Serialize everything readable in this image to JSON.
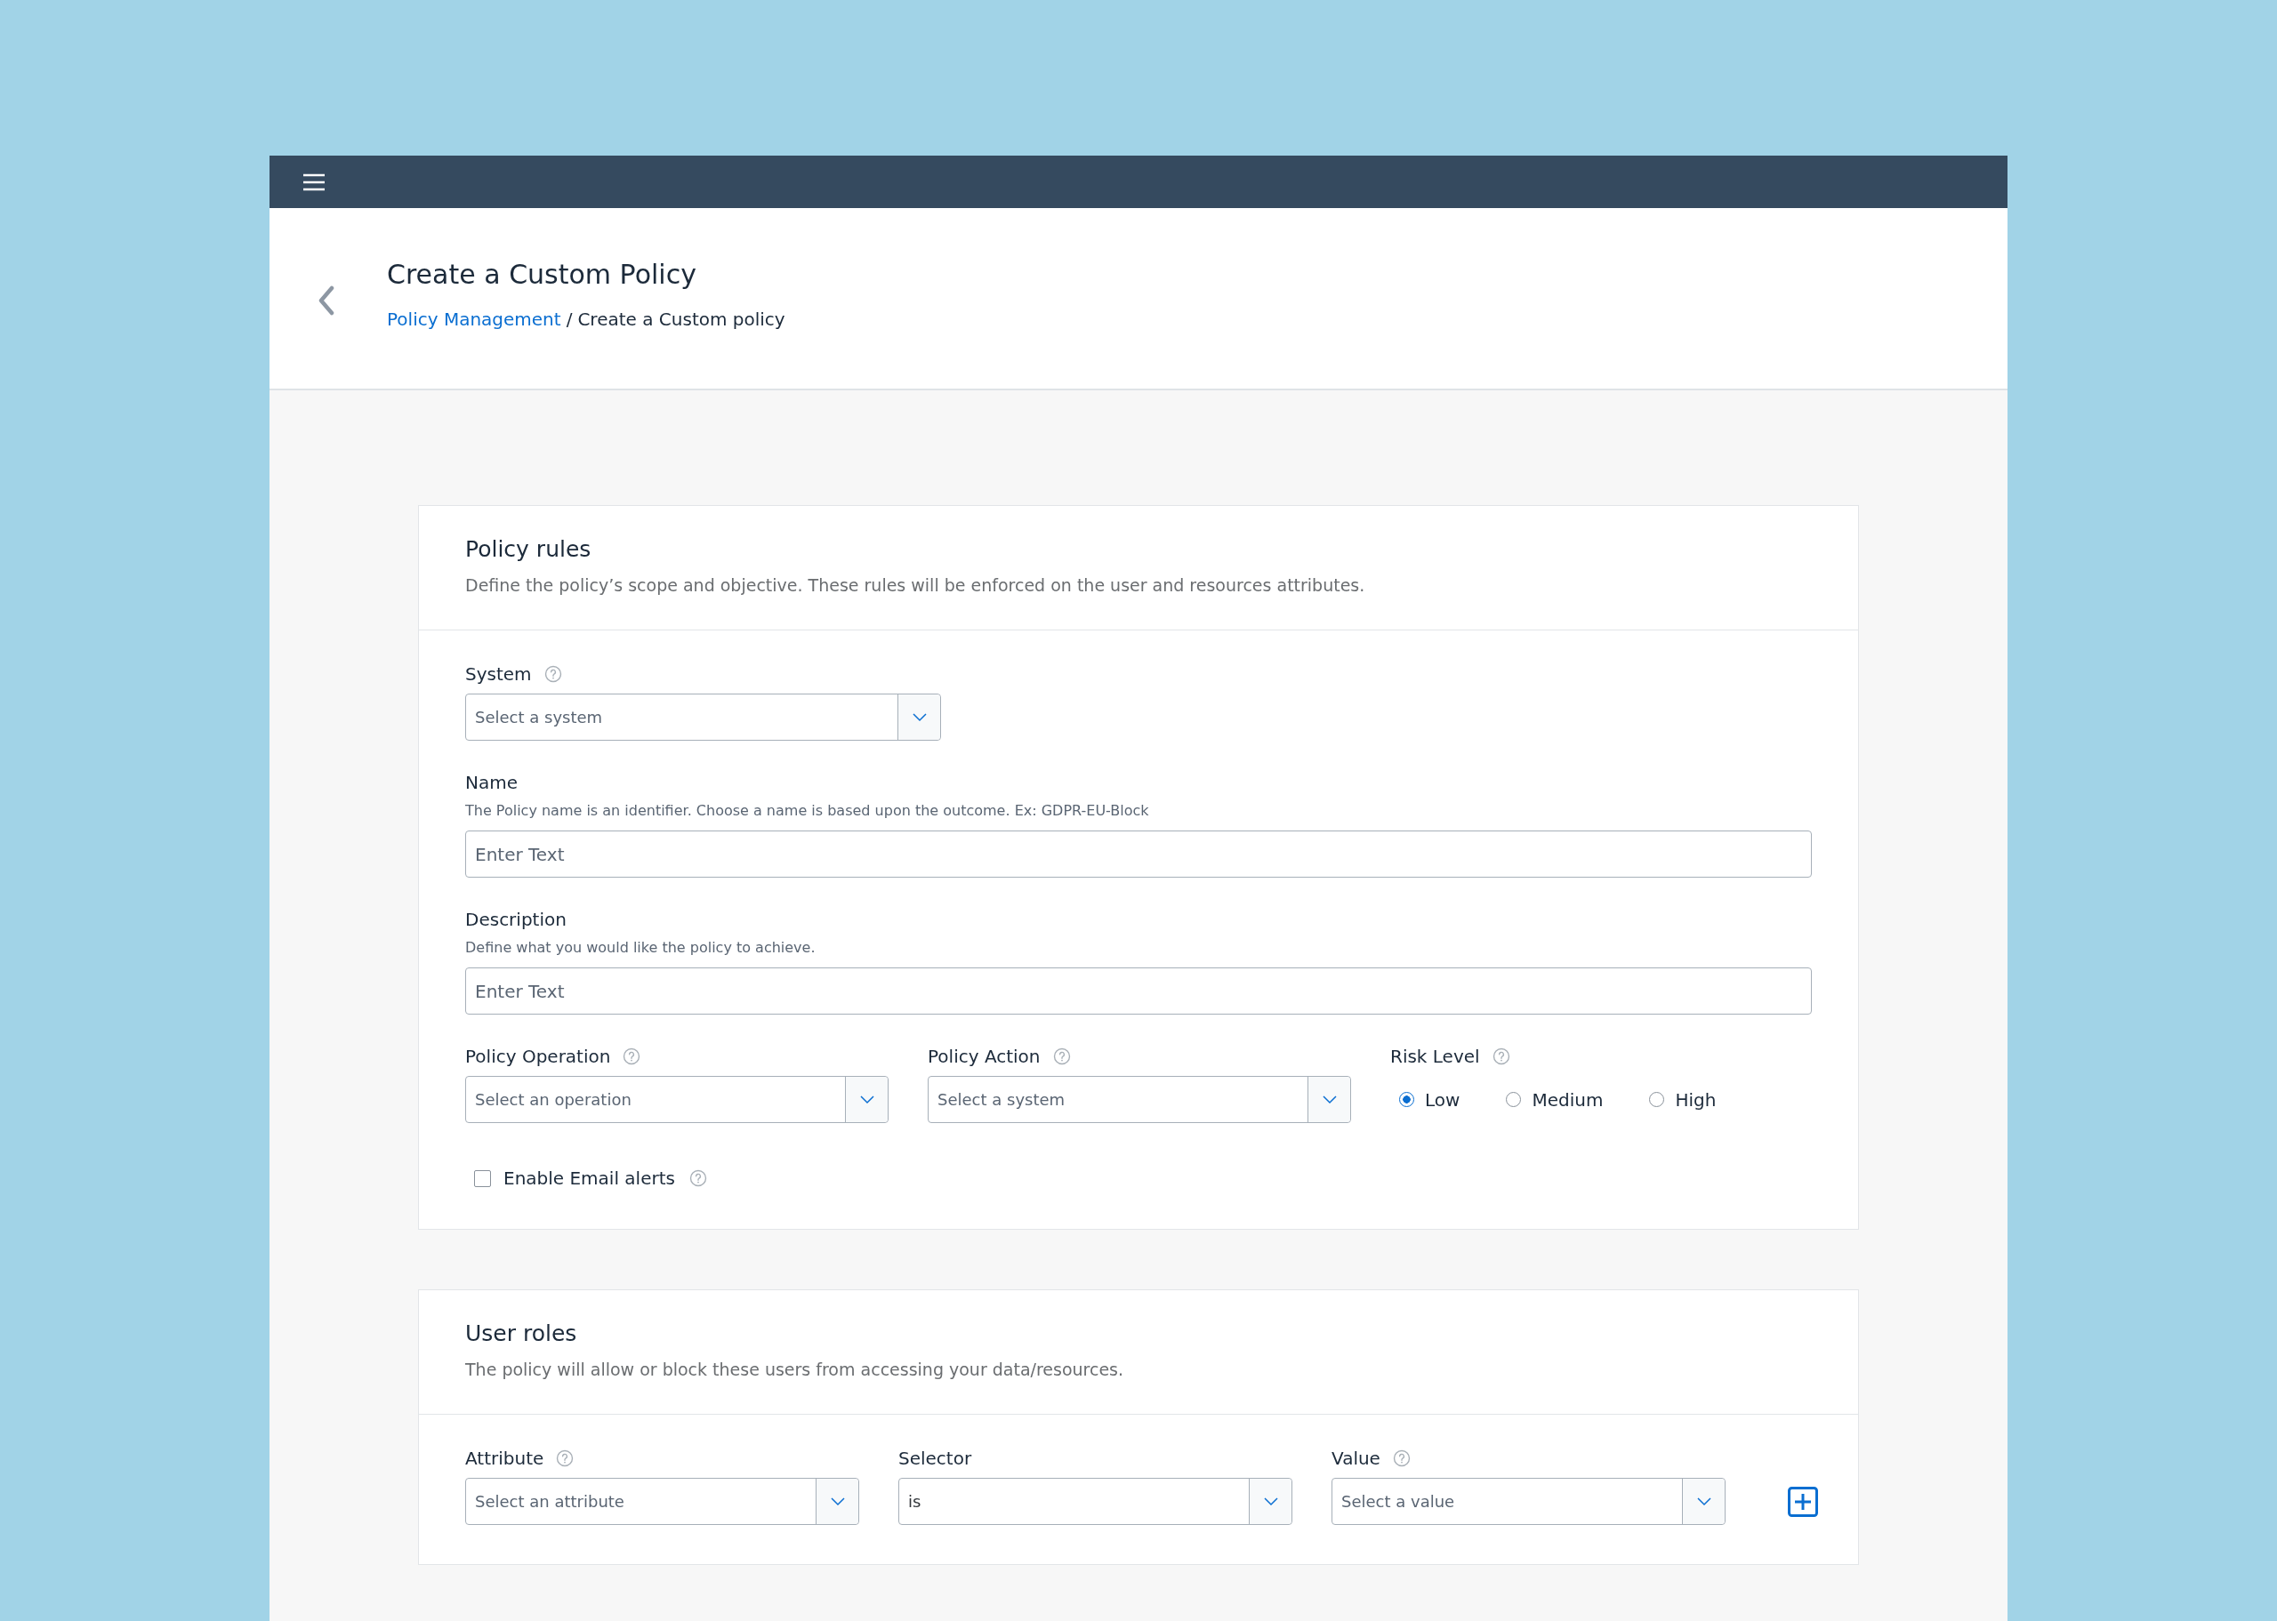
{
  "top_bar": {
    "menu": true
  },
  "header": {
    "title": "Create a Custom Policy",
    "breadcrumb": {
      "link": "Policy Management",
      "separator": "/",
      "current": "Create a Custom policy"
    }
  },
  "sections": [
    {
      "title": "Policy rules",
      "description": "Define the policy’s scope and objective. These rules will be enforced on the user and resources attributes.",
      "rows": [
        {
          "fields": [
            {
              "kind": "select",
              "label": "System",
              "help": true,
              "placeholder": "Select a system"
            }
          ]
        },
        {
          "fields": [
            {
              "kind": "text",
              "label": "Name",
              "hint": "The Policy name is an identifier. Choose a name is based upon the outcome. Ex: GDPR-EU-Block",
              "placeholder": "Enter Text"
            }
          ]
        },
        {
          "fields": [
            {
              "kind": "text",
              "label": "Description",
              "hint": "Define what you would like the policy to achieve.",
              "placeholder": "Enter Text"
            }
          ]
        },
        {
          "fields": [
            {
              "kind": "select",
              "label": "Policy Operation",
              "help": true,
              "placeholder": "Select an operation"
            },
            {
              "kind": "select",
              "label": "Policy Action",
              "help": true,
              "placeholder": "Select a system"
            },
            {
              "kind": "radio",
              "label": "Risk Level",
              "help": true,
              "options": [
                {
                  "label": "Low",
                  "selected": true
                },
                {
                  "label": "Medium",
                  "selected": false
                },
                {
                  "label": "High",
                  "selected": false
                }
              ]
            }
          ]
        },
        {
          "fields": [
            {
              "kind": "checkbox",
              "label": "Enable Email alerts",
              "help": true,
              "checked": false
            }
          ]
        }
      ]
    },
    {
      "title": "User roles",
      "description": "The policy will allow or block these users from accessing your data/resources.",
      "rows": [
        {
          "fields": [
            {
              "kind": "select",
              "label": "Attribute",
              "help": true,
              "placeholder": "Select an attribute"
            },
            {
              "kind": "select",
              "label": "Selector",
              "help": false,
              "value": "is"
            },
            {
              "kind": "select",
              "label": "Value",
              "help": true,
              "placeholder": "Select a value"
            },
            {
              "kind": "add"
            }
          ]
        }
      ]
    }
  ]
}
